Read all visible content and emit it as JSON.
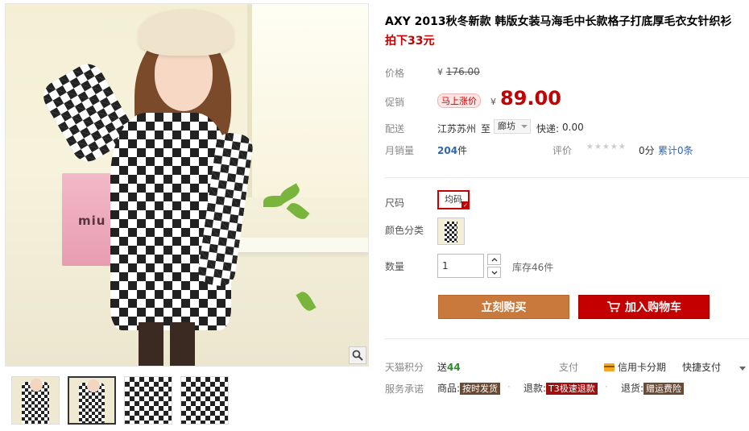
{
  "product": {
    "title": "AXY 2013秋冬新款 韩版女装马海毛中长款格子打底厚毛衣女针织衫",
    "promo_text": "拍下33元"
  },
  "gallery": {
    "bag_text": "miu",
    "thumbnail_count": 4,
    "active_thumbnail": 2
  },
  "price": {
    "label": "价格",
    "currency": "¥",
    "original": "176.00",
    "promo_label": "促销",
    "badge": "马上涨价",
    "current": "89.00"
  },
  "shipping": {
    "label": "配送",
    "from": "江苏苏州",
    "to_word": "至",
    "destination": "廊坊",
    "fee_label": "快递:",
    "fee": "0.00"
  },
  "sales": {
    "label": "月销量",
    "count": "204",
    "unit": "件",
    "rating_label": "评价",
    "stars": "★★★★★",
    "score": "0分",
    "review_link": "累计0条"
  },
  "options": {
    "size_label": "尺码",
    "size_value": "均码",
    "color_label": "颜色分类",
    "qty_label": "数量",
    "qty_value": "1",
    "stock": "库存46件"
  },
  "actions": {
    "buy_now": "立刻购买",
    "add_to_cart": "加入购物车"
  },
  "footer": {
    "points_label": "天猫积分",
    "points_prefix": "送",
    "points_value": "44",
    "pay_label": "支付",
    "credit_card": "信用卡分期",
    "quick_pay": "快捷支付",
    "service_label": "服务承诺",
    "goods_label": "商品:",
    "goods_tag": "按时发货",
    "refund_label": "退款:",
    "refund_tag": "T3极速退款",
    "return_label": "退货:",
    "return_tag": "赠运费险"
  },
  "colors": {
    "accent_red": "#c40000",
    "buy_button": "#c9793c",
    "link_blue": "#3366aa"
  }
}
